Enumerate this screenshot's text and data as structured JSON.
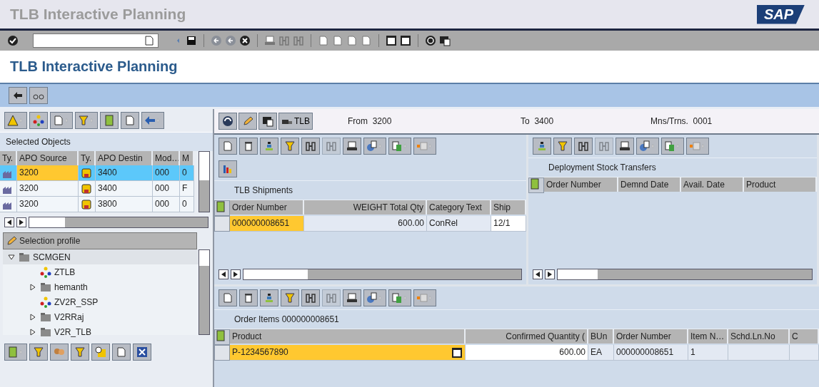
{
  "title_bar": {
    "title": "TLB Interactive Planning",
    "logo": "SAP"
  },
  "page_title": "TLB Interactive Planning",
  "selected_objects": {
    "title": "Selected Objects",
    "columns": [
      "Ty.",
      "APO Source",
      "Ty.",
      "APO Destin",
      "Mod…",
      "M"
    ],
    "rows": [
      {
        "source": "3200",
        "destination": "3400",
        "mod": "000",
        "m": "0",
        "selected": true,
        "focused": true
      },
      {
        "source": "3200",
        "destination": "3400",
        "mod": "000",
        "m": "F",
        "selected": false,
        "focused": false
      },
      {
        "source": "3200",
        "destination": "3800",
        "mod": "000",
        "m": "0",
        "selected": false,
        "focused": false
      }
    ]
  },
  "selection_profile": {
    "title": "Selection profile",
    "tree": [
      {
        "label": "SCMGEN",
        "kind": "folder",
        "expanded": true,
        "children": [
          {
            "label": "ZTLB",
            "kind": "profile"
          },
          {
            "label": "hemanth",
            "kind": "folder",
            "expanded": false
          },
          {
            "label": "ZV2R_SSP",
            "kind": "profile"
          },
          {
            "label": "V2RRaj",
            "kind": "folder",
            "expanded": false
          },
          {
            "label": "V2R_TLB",
            "kind": "folder",
            "expanded": false
          }
        ]
      }
    ]
  },
  "header": {
    "button": "TLB",
    "fields": [
      {
        "label": "From",
        "value": "3200"
      },
      {
        "label": "To",
        "value": "3400"
      },
      {
        "label": "Mns/Trns.",
        "value": "0001"
      }
    ]
  },
  "shipments": {
    "title": "TLB Shipments",
    "columns": [
      "Order Number",
      "WEIGHT Total Qty",
      "Category Text",
      "Ship"
    ],
    "rows": [
      {
        "cells": [
          "000000008651",
          "600.00",
          "ConRel",
          "12/1"
        ],
        "focused": true
      }
    ]
  },
  "deployment": {
    "title": "Deployment Stock Transfers",
    "columns": [
      "Order Number",
      "Demnd Date",
      "Avail. Date",
      "Product"
    ]
  },
  "order_items": {
    "title": "Order Items 000000008651",
    "columns": [
      "Product",
      "Confirmed Quantity (",
      "BUn",
      "Order Number",
      "Item N…",
      "Schd.Ln.No",
      "C"
    ],
    "rows": [
      {
        "cells": [
          "P-1234567890",
          "600.00",
          "EA",
          "000000008651",
          "1",
          "",
          ""
        ],
        "focused": true
      }
    ]
  }
}
